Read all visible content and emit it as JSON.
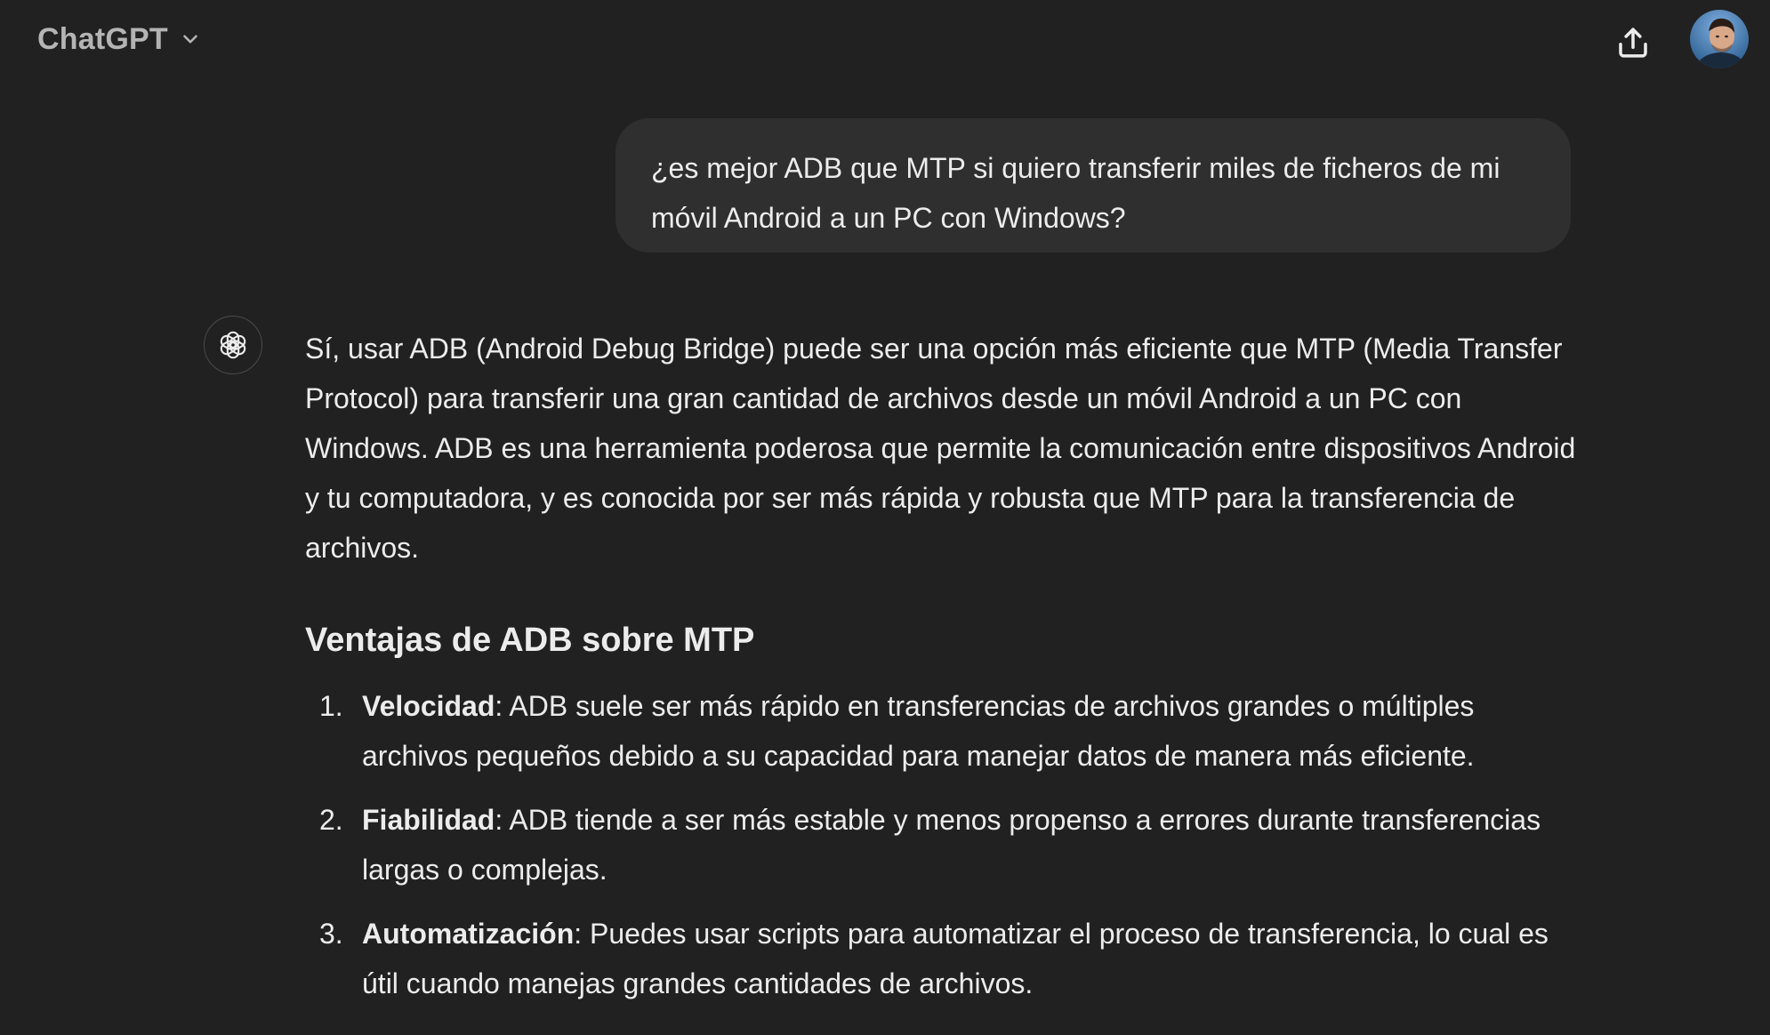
{
  "header": {
    "model_name": "ChatGPT",
    "chevron_icon": "chevron-down-icon",
    "share_icon": "share-upload-icon",
    "avatar": "user-avatar"
  },
  "conversation": {
    "user_message": "¿es mejor ADB que MTP si quiero transferir miles de ficheros de mi móvil Android a un PC con Windows?",
    "assistant": {
      "icon": "openai-logo-icon",
      "intro": "Sí, usar ADB (Android Debug Bridge) puede ser una opción más eficiente que MTP (Media Transfer Protocol) para transferir una gran cantidad de archivos desde un móvil Android a un PC con Windows. ADB es una herramienta poderosa que permite la comunicación entre dispositivos Android y tu computadora, y es conocida por ser más rápida y robusta que MTP para la transferencia de archivos.",
      "heading": "Ventajas de ADB sobre MTP",
      "items": [
        {
          "number": "1.",
          "term": "Velocidad",
          "text": ": ADB suele ser más rápido en transferencias de archivos grandes o múltiples archivos pequeños debido a su capacidad para manejar datos de manera más eficiente."
        },
        {
          "number": "2.",
          "term": "Fiabilidad",
          "text": ": ADB tiende a ser más estable y menos propenso a errores durante transferencias largas o complejas."
        },
        {
          "number": "3.",
          "term": "Automatización",
          "text": ": Puedes usar scripts para automatizar el proceso de transferencia, lo cual es útil cuando manejas grandes cantidades de archivos."
        }
      ]
    }
  },
  "colors": {
    "background": "#212121",
    "bubble": "#2f2f2f",
    "text": "#ececec",
    "muted": "#b4b4b4"
  }
}
